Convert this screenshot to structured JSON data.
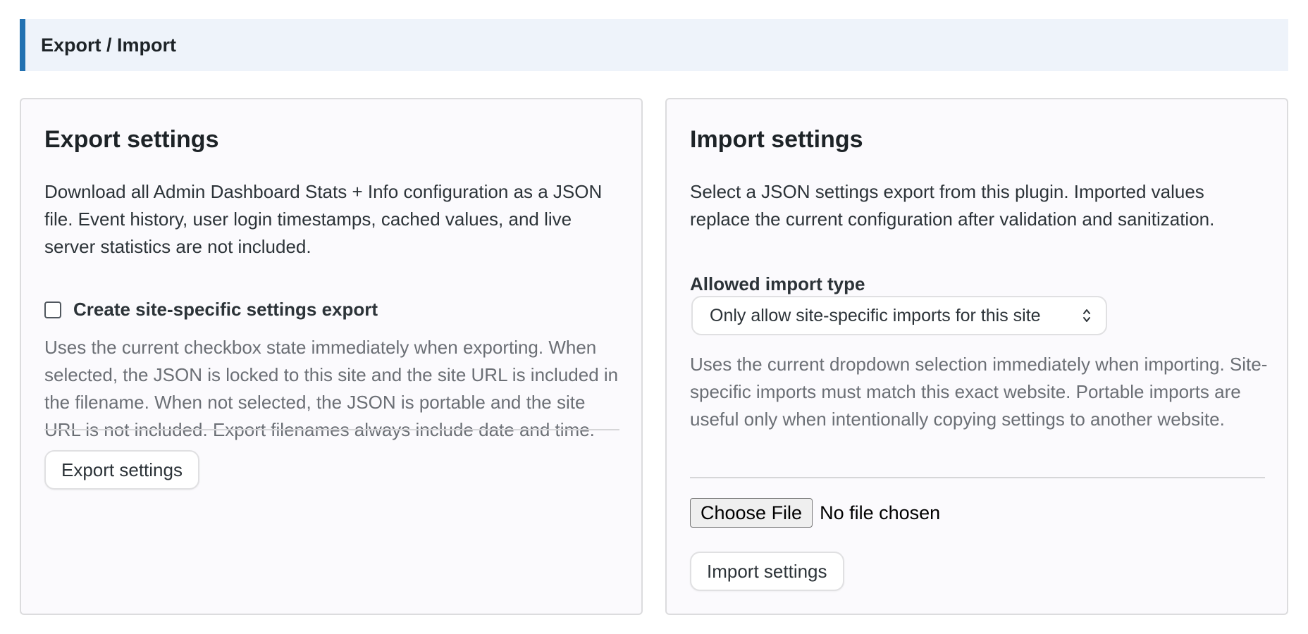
{
  "section": {
    "title": "Export / Import"
  },
  "export": {
    "heading": "Export settings",
    "description": "Download all Admin Dashboard Stats + Info configuration as a JSON file. Event history, user login timestamps, cached values, and live server statistics are not included.",
    "checkbox_label": "Create site-specific settings export",
    "checkbox_checked": false,
    "help": "Uses the current checkbox state immediately when exporting. When selected, the JSON is locked to this site and the site URL is included in the filename. When not selected, the JSON is portable and the site URL is not included. Export filenames always include date and time.",
    "button_label": "Export settings"
  },
  "import": {
    "heading": "Import settings",
    "description": "Select a JSON settings export from this plugin. Imported values replace the current configuration after validation and sanitization.",
    "type_label": "Allowed import type",
    "type_selected": "Only allow site-specific imports for this site",
    "help": "Uses the current dropdown selection immediately when importing. Site-specific imports must match this exact website. Portable imports are useful only when intentionally copying settings to another website.",
    "file_button_label": "Choose File",
    "file_status": "No file chosen",
    "button_label": "Import settings"
  },
  "colors": {
    "accent": "#2271b1",
    "header_bg": "#eef3fa",
    "card_bg": "#fbfafd",
    "help_text": "#6b6f75"
  }
}
